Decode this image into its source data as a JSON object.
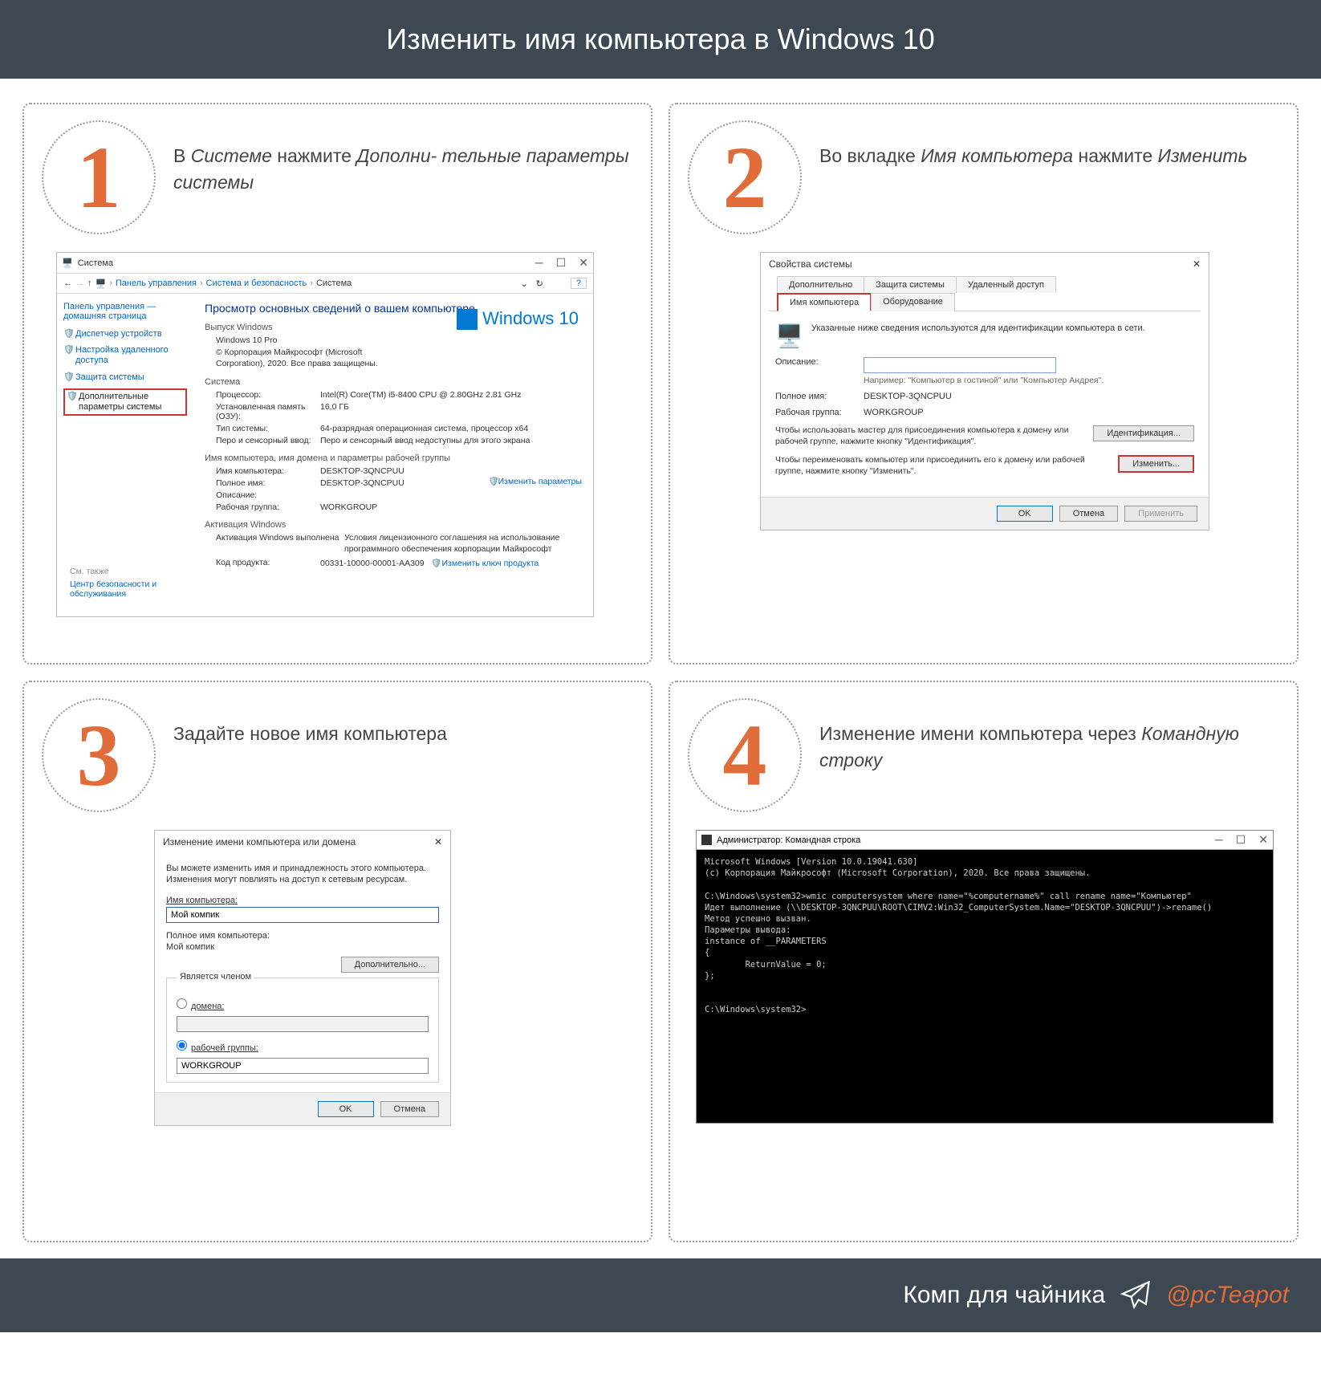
{
  "header": "Изменить имя компьютера в Windows 10",
  "steps": [
    {
      "num": "1",
      "desc_pre": "В ",
      "desc_em1": "Системе",
      "desc_mid": " нажмите ",
      "desc_em2": "Дополни- тельные параметры системы"
    },
    {
      "num": "2",
      "desc_pre": "Во вкладке ",
      "desc_em1": "Имя компьютера",
      "desc_mid": " нажмите ",
      "desc_em2": "Изменить"
    },
    {
      "num": "3",
      "desc_pre": "Задайте новое имя компьютера",
      "desc_em1": "",
      "desc_mid": "",
      "desc_em2": ""
    },
    {
      "num": "4",
      "desc_pre": "Изменение имени компьютера через ",
      "desc_em1": "Командную строку",
      "desc_mid": "",
      "desc_em2": ""
    }
  ],
  "win1": {
    "title": "Система",
    "bc": [
      "Панель управления",
      "Система и безопасность",
      "Система"
    ],
    "qmark": "?",
    "sidebar": {
      "home": "Панель управления — домашняя страница",
      "items": [
        "Диспетчер устройств",
        "Настройка удаленного доступа",
        "Защита системы",
        "Дополнительные параметры системы"
      ]
    },
    "main_title": "Просмотр основных сведений о вашем компьютере",
    "sec_win": "Выпуск Windows",
    "edition": "Windows 10 Pro",
    "copyright": "© Корпорация Майкрософт (Microsoft Corporation), 2020. Все права защищены.",
    "logo": "Windows 10",
    "sec_sys": "Система",
    "rows_sys": [
      {
        "l": "Процессор:",
        "v": "Intel(R) Core(TM) i5-8400 CPU @ 2.80GHz  2.81 GHz"
      },
      {
        "l": "Установленная память (ОЗУ):",
        "v": "16,0 ГБ"
      },
      {
        "l": "Тип системы:",
        "v": "64-разрядная операционная система, процессор x64"
      },
      {
        "l": "Перо и сенсорный ввод:",
        "v": "Перо и сенсорный ввод недоступны для этого экрана"
      }
    ],
    "sec_name": "Имя компьютера, имя домена и параметры рабочей группы",
    "rows_name": [
      {
        "l": "Имя компьютера:",
        "v": "DESKTOP-3QNCPUU"
      },
      {
        "l": "Полное имя:",
        "v": "DESKTOP-3QNCPUU"
      },
      {
        "l": "Описание:",
        "v": ""
      },
      {
        "l": "Рабочая группа:",
        "v": "WORKGROUP"
      }
    ],
    "chg_link": "Изменить параметры",
    "sec_act": "Активация Windows",
    "act_text": "Активация Windows выполнена",
    "act_link": "Условия лицензионного соглашения на использование программного обеспечения корпорации Майкрософт",
    "prod_l": "Код продукта:",
    "prod_v": "00331-10000-00001-AA309",
    "prod_link": "Изменить ключ продукта",
    "see_also": "См. также",
    "sec_link": "Центр безопасности и обслуживания"
  },
  "win2": {
    "title": "Свойства системы",
    "tabs_top": [
      "Дополнительно",
      "Защита системы",
      "Удаленный доступ"
    ],
    "tabs_bot": [
      "Имя компьютера",
      "Оборудование"
    ],
    "intro": "Указанные ниже сведения используются для идентификации компьютера в сети.",
    "desc_l": "Описание:",
    "hint": "Например: \"Компьютер в гостиной\" или \"Компьютер Андрея\".",
    "full_l": "Полное имя:",
    "full_v": "DESKTOP-3QNCPUU",
    "wg_l": "Рабочая группа:",
    "wg_v": "WORKGROUP",
    "join1": "Чтобы использовать мастер для присоединения компьютера к домену или рабочей группе, нажмите кнопку \"Идентификация\".",
    "btn_id": "Идентификация...",
    "join2": "Чтобы переименовать компьютер или присоединить его к домену или рабочей группе, нажмите кнопку \"Изменить\".",
    "btn_chg": "Изменить...",
    "ok": "OK",
    "cancel": "Отмена",
    "apply": "Применить"
  },
  "win3": {
    "title": "Изменение имени компьютера или домена",
    "info": "Вы можете изменить имя и принадлежность этого компьютера. Изменения могут повлиять на доступ к сетевым ресурсам.",
    "name_l": "Имя компьютера:",
    "name_v": "Мой компик",
    "full_l": "Полное имя компьютера:",
    "full_v": "Мой компик",
    "adv": "Дополнительно...",
    "member": "Является членом",
    "r_domain": "домена:",
    "r_wg": "рабочей группы:",
    "wg_v": "WORKGROUP",
    "ok": "OK",
    "cancel": "Отмена"
  },
  "cmd": {
    "title": "Администратор: Командная строка",
    "lines": "Microsoft Windows [Version 10.0.19041.630]\n(c) Корпорация Майкрософт (Microsoft Corporation), 2020. Все права защищены.\n\nC:\\Windows\\system32>wmic computersystem where name=\"%computername%\" call rename name=\"Компьютер\"\nИдет выполнение (\\\\DESKTOP-3QNCPUU\\ROOT\\CIMV2:Win32_ComputerSystem.Name=\"DESKTOP-3QNCPUU\")->rename()\nМетод успешно вызван.\nПараметры вывода:\ninstance of __PARAMETERS\n{\n        ReturnValue = 0;\n};\n\n\nC:\\Windows\\system32>"
  },
  "footer": {
    "text": "Комп для чайника",
    "handle": "@pcTeapot"
  }
}
